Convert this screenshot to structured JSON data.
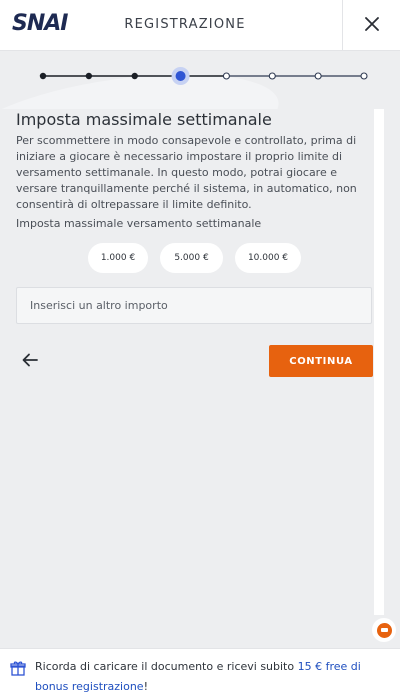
{
  "header": {
    "logo_text": "SNAI",
    "title": "REGISTRAZIONE",
    "close_icon": "close-icon"
  },
  "stepper": {
    "total_steps": 8,
    "current_step": 4,
    "completed_color": "#1b1f26",
    "active_color": "#2f55d4",
    "upcoming_color": "#2f3a52"
  },
  "main": {
    "title": "Imposta massimale settimanale",
    "description": "Per scommettere in modo consapevole e controllato, prima di iniziare a giocare è necessario impostare il proprio limite di versamento settimanale. In questo modo, potrai giocare e versare tranquillamente perché il sistema, in automatico, non consentirà di oltrepassare il limite definito.",
    "section_label": "Imposta massimale versamento settimanale",
    "amounts": [
      "1.000 €",
      "5.000 €",
      "10.000 €"
    ],
    "custom_amount_placeholder": "Inserisci un altro importo",
    "custom_amount_value": "",
    "back_icon": "arrow-left-icon",
    "continue_label": "CONTINUA"
  },
  "banner": {
    "text_before": "Ricorda di caricare il documento e ricevi subito ",
    "link_text": "15 € free di bonus registrazione",
    "text_after": "!",
    "icon": "gift-icon"
  },
  "colors": {
    "accent": "#e7620f",
    "link": "#1f4fbf",
    "background": "#edeef0"
  }
}
